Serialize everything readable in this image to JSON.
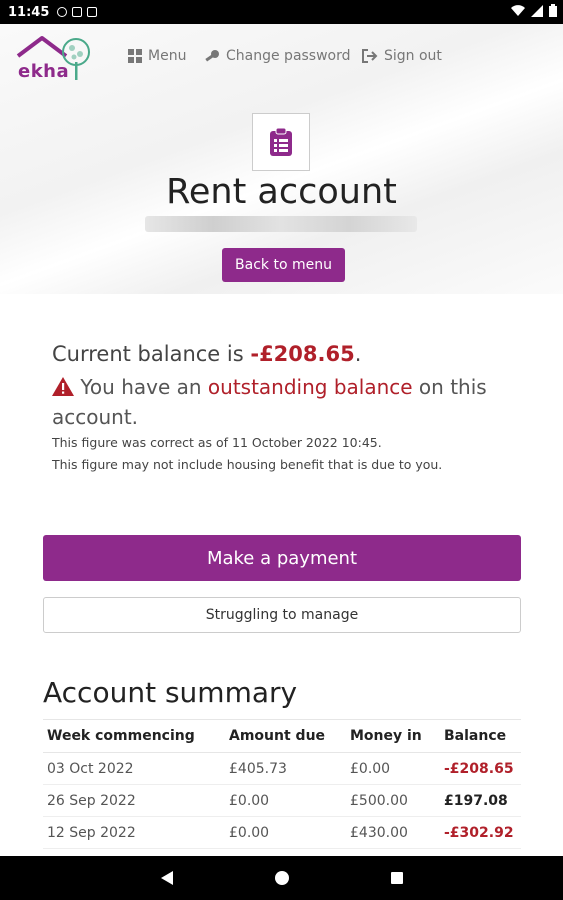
{
  "status_bar": {
    "time": "11:45",
    "icons": [
      "facebook-icon",
      "sim-icon",
      "calendar-icon",
      "wifi-icon",
      "signal-icon",
      "battery-icon"
    ]
  },
  "header": {
    "logo_text": "ekha",
    "nav": {
      "menu": "Menu",
      "change_password": "Change password",
      "sign_out": "Sign out"
    }
  },
  "page": {
    "title": "Rent account",
    "back_button": "Back to menu"
  },
  "balance": {
    "prefix": "Current balance is ",
    "amount": "-£208.65",
    "suffix": ".",
    "warning_prefix": " You have an ",
    "warning_link": "outstanding balance",
    "warning_suffix": " on this account.",
    "note_1": "This figure was correct as of 11 October 2022 10:45.",
    "note_2": "This figure may not include housing benefit that is due to you."
  },
  "actions": {
    "make_payment": "Make a payment",
    "struggling": "Struggling to manage"
  },
  "summary": {
    "title": "Account summary",
    "columns": [
      "Week commencing",
      "Amount due",
      "Money in",
      "Balance"
    ],
    "rows": [
      {
        "week": "03 Oct 2022",
        "due": "£405.73",
        "in": "£0.00",
        "balance": "-£208.65",
        "negative": true
      },
      {
        "week": "26 Sep 2022",
        "due": "£0.00",
        "in": "£500.00",
        "balance": "£197.08",
        "negative": false
      },
      {
        "week": "12 Sep 2022",
        "due": "£0.00",
        "in": "£430.00",
        "balance": "-£302.92",
        "negative": true
      }
    ]
  },
  "colors": {
    "brand_purple": "#8e2a8b",
    "negative_red": "#b0202a",
    "logo_green": "#4aa98a"
  }
}
